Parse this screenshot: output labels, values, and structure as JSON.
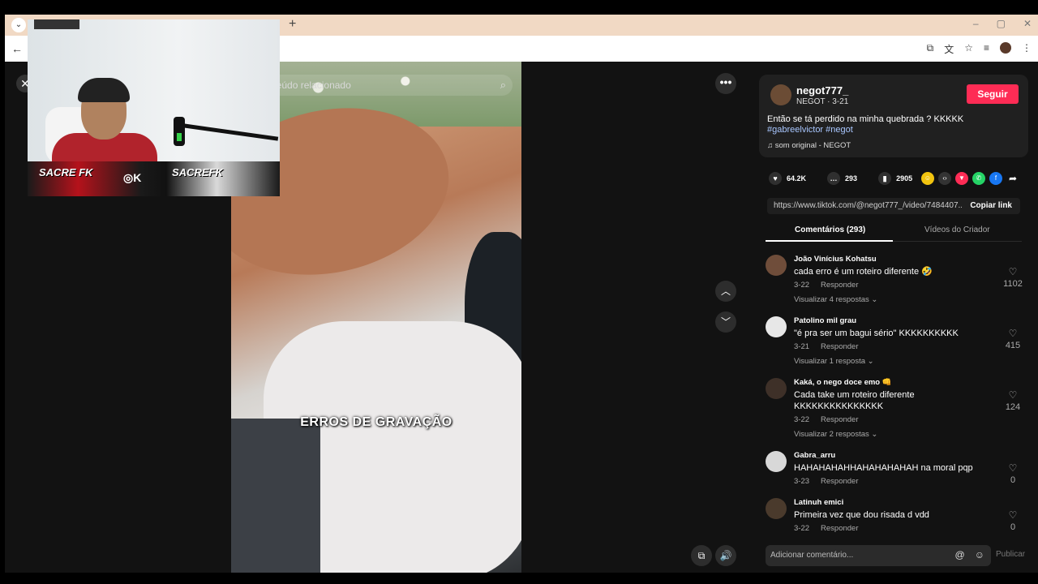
{
  "browser": {
    "tab_dropdown_icon": "chevron-down-icon",
    "new_tab_label": "+",
    "window_controls": [
      "–",
      "▢",
      "✕"
    ],
    "back_label": "←"
  },
  "viewer": {
    "close_label": "✕",
    "search_placeholder": "ar conteúdo relacionado",
    "more_label": "•••",
    "caption": "ERROS DE GRAVAÇÃO",
    "nav_up": "︿",
    "nav_down": "﹀"
  },
  "webcam": {
    "banner_left": "SACRE FK",
    "banner_right": "SACREFK",
    "social_icons": "◎K"
  },
  "post": {
    "author": "negot777_",
    "meta": "NEGOT · 3-21",
    "follow_label": "Seguir",
    "description": "Então se tá perdido na minha quebrada ? KKKKK",
    "hashtags": "#gabreelvictor #negot",
    "music_icon": "♫",
    "music": "som original - NEGOT",
    "likes": "64.2K",
    "comments": "293",
    "saves": "2905",
    "link": "https://www.tiktok.com/@negot777_/video/7484407...",
    "copy_link_label": "Copiar link",
    "tab_comments": "Comentários (293)",
    "tab_creator": "Vídeos do Criador"
  },
  "comments": [
    {
      "user": "João Vinícius Kohatsu",
      "text": "cada erro é um roteiro diferente 🤣",
      "date": "3-22",
      "reply": "Responder",
      "replies": "Visualizar 4 respostas ⌄",
      "likes": "1102"
    },
    {
      "user": "Patolino mil grau",
      "text": "\"é pra ser um bagui sério\" KKKKKKKKKK",
      "date": "3-21",
      "reply": "Responder",
      "replies": "Visualizar 1 resposta ⌄",
      "likes": "415"
    },
    {
      "user": "Kaká, o nego doce emo 👊",
      "text": "Cada take um roteiro diferente KKKKKKKKKKKKKKK",
      "date": "3-22",
      "reply": "Responder",
      "replies": "Visualizar 2 respostas ⌄",
      "likes": "124"
    },
    {
      "user": "Gabra_arru",
      "text": "HAHAHAHAHHAHAHAHAHAH na moral pqp",
      "date": "3-23",
      "reply": "Responder",
      "replies": "",
      "likes": "0"
    },
    {
      "user": "Latinuh emici",
      "text": "Primeira vez que dou risada d vdd",
      "date": "3-22",
      "reply": "Responder",
      "replies": "",
      "likes": "0"
    }
  ],
  "composer": {
    "placeholder": "Adicionar comentário...",
    "mention_icon": "@",
    "emoji_icon": "☺",
    "publish_label": "Publicar"
  }
}
